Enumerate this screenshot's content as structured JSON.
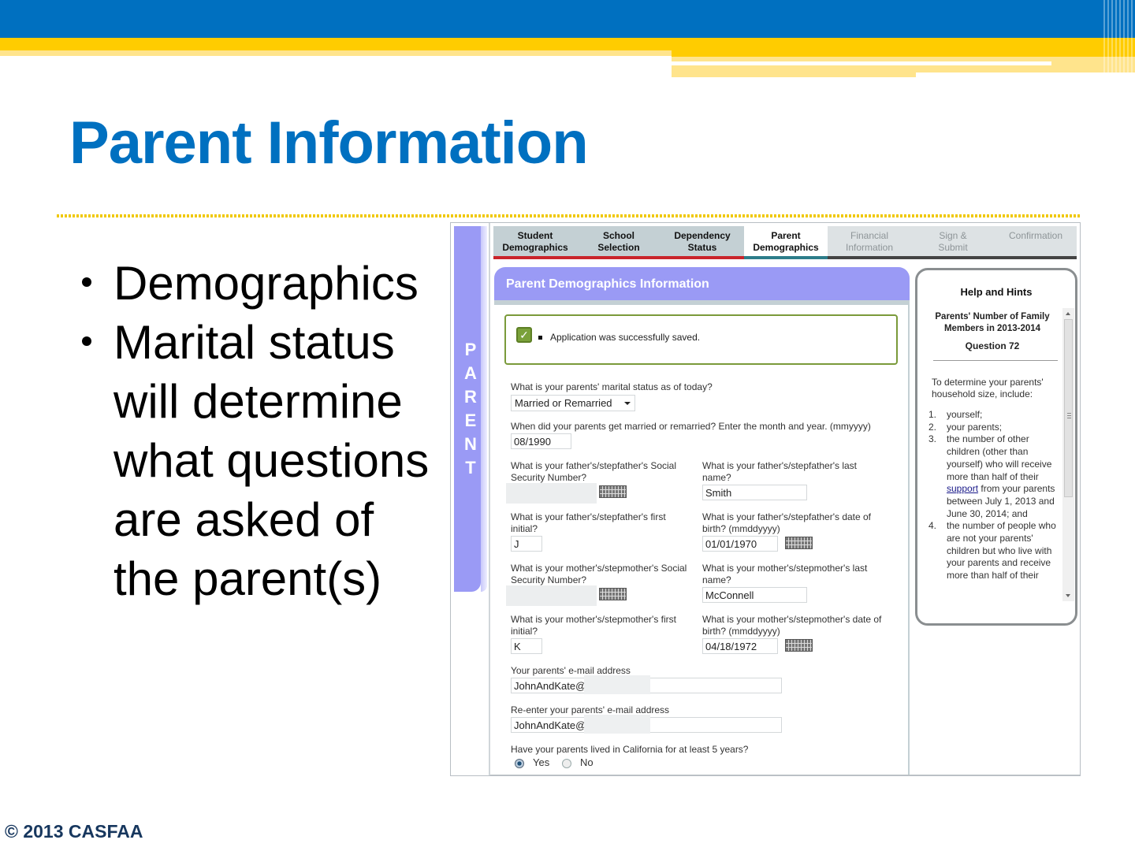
{
  "slide": {
    "title": "Parent Information",
    "bullets": [
      "Demographics",
      "Marital status will determine what questions are asked of the parent(s)"
    ],
    "copyright": "© 2013 CASFAA",
    "colors": {
      "title": "#0070c0",
      "header_blue": "#0070c0",
      "header_yellow": "#ffcc00"
    }
  },
  "app": {
    "side_tab_letters": [
      "P",
      "A",
      "R",
      "E",
      "N",
      "T"
    ],
    "tabs": [
      {
        "line1": "Student",
        "line2": "Demographics",
        "state": "done"
      },
      {
        "line1": "School",
        "line2": "Selection",
        "state": "done"
      },
      {
        "line1": "Dependency",
        "line2": "Status",
        "state": "done"
      },
      {
        "line1": "Parent",
        "line2": "Demographics",
        "state": "active"
      },
      {
        "line1": "Financial",
        "line2": "Information",
        "state": "todo"
      },
      {
        "line1": "Sign &",
        "line2": "Submit",
        "state": "todo"
      },
      {
        "line1": "Confirmation",
        "line2": "",
        "state": "todo"
      }
    ],
    "panel_title": "Parent Demographics Information",
    "saved_message": "Application was successfully saved.",
    "form": {
      "marital_status": {
        "label": "What is your parents' marital status as of today?",
        "value": "Married or Remarried"
      },
      "married_date": {
        "label": "When did your parents get married or remarried? Enter the month and year. (mmyyyy)",
        "value": "08/1990"
      },
      "father_ssn": {
        "label": "What is your father's/stepfather's Social Security Number?",
        "value": ""
      },
      "father_last": {
        "label": "What is your father's/stepfather's last name?",
        "value": "Smith"
      },
      "father_initial": {
        "label": "What is your father's/stepfather's first initial?",
        "value": "J"
      },
      "father_dob": {
        "label": "What is your father's/stepfather's date of birth? (mmddyyyy)",
        "value": "01/01/1970"
      },
      "mother_ssn": {
        "label": "What is your mother's/stepmother's Social Security Number?",
        "value": ""
      },
      "mother_last": {
        "label": "What is your mother's/stepmother's last name?",
        "value": "McConnell"
      },
      "mother_initial": {
        "label": "What is your mother's/stepmother's first initial?",
        "value": "K"
      },
      "mother_dob": {
        "label": "What is your mother's/stepmother's date of birth? (mmddyyyy)",
        "value": "04/18/1972"
      },
      "email": {
        "label": "Your parents' e-mail address",
        "value": "JohnAndKate@"
      },
      "email_confirm": {
        "label": "Re-enter your parents' e-mail address",
        "value": "JohnAndKate@"
      },
      "california": {
        "label": "Have your parents lived in California for at least 5 years?",
        "options": [
          "Yes",
          "No"
        ],
        "selected": "Yes"
      }
    },
    "help": {
      "title": "Help and Hints",
      "subtitle": "Parents' Number of Family Members in 2013-2014",
      "question": "Question 72",
      "intro": "To determine your parents' household size, include:",
      "items": [
        {
          "num": "1.",
          "text": "yourself;"
        },
        {
          "num": "2.",
          "text": "your parents;"
        },
        {
          "num": "3.",
          "text_before": "the number of other children (other than yourself) who will receive more than half of their ",
          "link": "support",
          "text_after": " from your parents between July 1, 2013 and June 30, 2014; and"
        },
        {
          "num": "4.",
          "text": "the number of people who are not your parents' children but who live with your parents and receive more than half of their"
        }
      ]
    }
  }
}
